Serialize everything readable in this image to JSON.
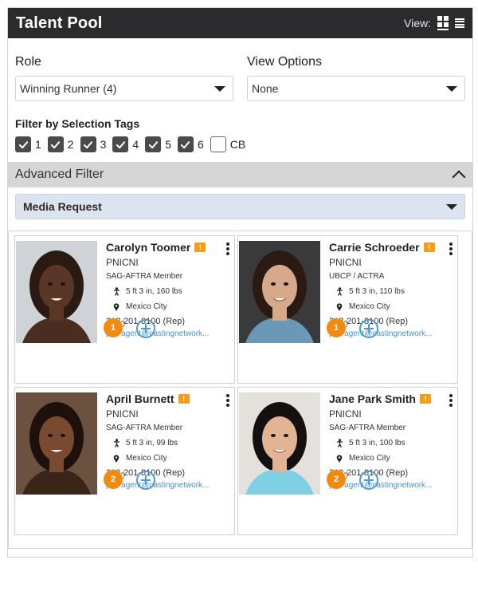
{
  "header": {
    "title": "Talent Pool",
    "view_label": "View:"
  },
  "role": {
    "label": "Role",
    "value": "Winning Runner (4)"
  },
  "view_options": {
    "label": "View Options",
    "value": "None"
  },
  "tags": {
    "title": "Filter by Selection Tags",
    "items": [
      {
        "label": "1",
        "checked": true
      },
      {
        "label": "2",
        "checked": true
      },
      {
        "label": "3",
        "checked": true
      },
      {
        "label": "4",
        "checked": true
      },
      {
        "label": "5",
        "checked": true
      },
      {
        "label": "6",
        "checked": true
      },
      {
        "label": "CB",
        "checked": false
      }
    ]
  },
  "advanced_filter": {
    "label": "Advanced Filter"
  },
  "media_request": {
    "value": "Media Request"
  },
  "flag_glyph": "!",
  "cards": [
    {
      "name": "Carolyn Toomer",
      "company": "PNICNI",
      "union": "SAG-AFTRA Member",
      "stats": "5 ft 3 in, 160 lbs",
      "location": "Mexico City",
      "phone": "213-201-8100 (Rep)",
      "email": "pni+agent@castingnetwork...",
      "badge": "1",
      "badge_tail": ")"
    },
    {
      "name": "Carrie Schroeder",
      "company": "PNICNI",
      "union": "UBCP / ACTRA",
      "stats": "5 ft 3 in, 110 lbs",
      "location": "Mexico City",
      "phone": "213-201-8100 (Rep)",
      "email": "pni+agent@castingnetwork...",
      "badge": "1",
      "badge_tail": ")"
    },
    {
      "name": "April Burnett",
      "company": "PNICNI",
      "union": "SAG-AFTRA Member",
      "stats": "5 ft 3 in, 99 lbs",
      "location": "Mexico City",
      "phone": "213-201-8100 (Rep)",
      "email": "pni+agent@castingnetwork...",
      "badge": "2",
      "badge_tail": ")"
    },
    {
      "name": "Jane Park Smith",
      "company": "PNICNI",
      "union": "SAG-AFTRA Member",
      "stats": "5 ft 3 in, 100 lbs",
      "location": "Mexico City",
      "phone": "213-201-8100 (Rep)",
      "email": "pni+agent@castingnetwork...",
      "badge": "2",
      "badge_tail": ")"
    }
  ]
}
